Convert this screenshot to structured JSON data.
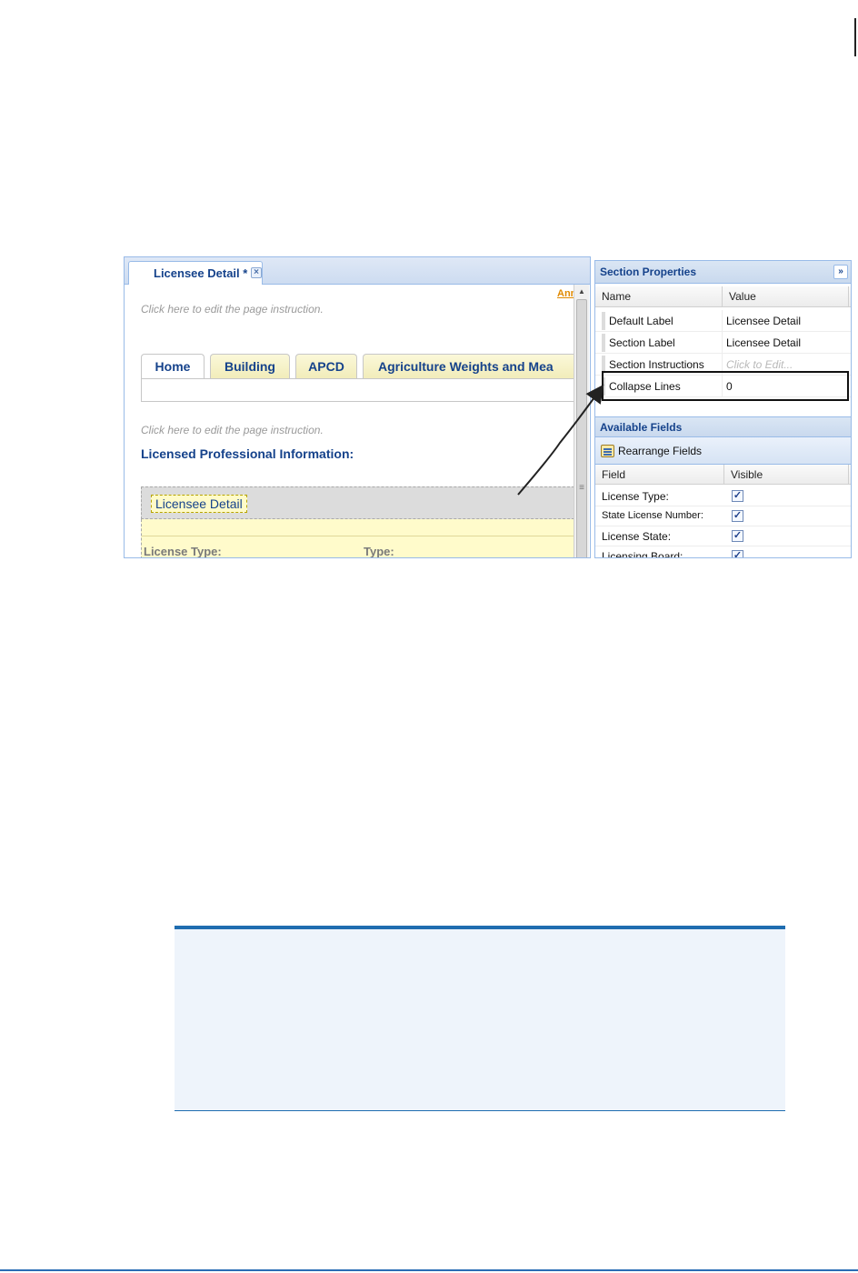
{
  "designer": {
    "doc_tab_label": "Licensee Detail *",
    "close_glyph": "×",
    "annotation_link": "Ann",
    "page_instruction_1": "Click here to edit the page instruction.",
    "page_instruction_2": "Click here to edit the page instruction.",
    "page_tabs": [
      "Home",
      "Building",
      "APCD",
      "Agriculture Weights and Mea"
    ],
    "section_heading": "Licensed Professional Information:",
    "section_label": "Licensee Detail",
    "field_labels": [
      "License Type:",
      "Type:"
    ]
  },
  "section_properties": {
    "title": "Section Properties",
    "collapse_glyph": "»",
    "columns": [
      "Name",
      "Value"
    ],
    "rows": [
      {
        "name": "Default Label",
        "value": "Licensee Detail"
      },
      {
        "name": "Section Label",
        "value": "Licensee Detail"
      },
      {
        "name": "Section Instructions",
        "value": "Click to Edit..."
      },
      {
        "name": "Collapse Lines",
        "value": "0"
      }
    ]
  },
  "available_fields": {
    "title": "Available Fields",
    "rearrange_label": "Rearrange Fields",
    "columns": [
      "Field",
      "Visible"
    ],
    "rows": [
      {
        "field": "License Type:",
        "visible": "✓"
      },
      {
        "field": "State License Number:",
        "visible": "✓"
      },
      {
        "field": "License State:",
        "visible": "✓"
      },
      {
        "field": "Licensing Board:",
        "visible": "✓"
      }
    ]
  },
  "colors": {
    "header_text": "#15428b",
    "panel_border": "#99bbe8",
    "section_fill": "#fffbcb",
    "note_rule": "#1f6db0"
  }
}
